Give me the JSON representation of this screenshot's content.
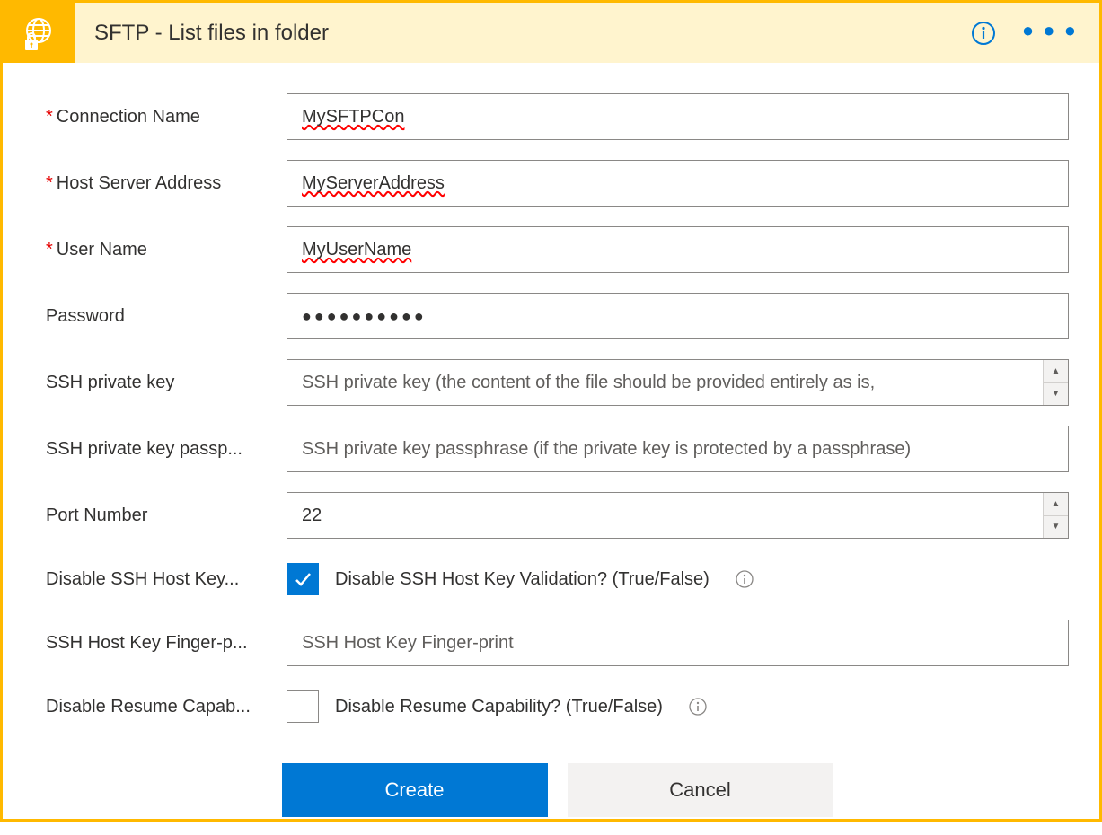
{
  "header": {
    "title": "SFTP - List files in folder"
  },
  "fields": {
    "connectionName": {
      "label": "Connection Name",
      "required": true,
      "value": "MySFTPCon"
    },
    "hostAddress": {
      "label": "Host Server Address",
      "required": true,
      "value": "MyServerAddress"
    },
    "userName": {
      "label": "User Name",
      "required": true,
      "value": "MyUserName"
    },
    "password": {
      "label": "Password",
      "required": false,
      "masked": "●●●●●●●●●●"
    },
    "sshKey": {
      "label": "SSH private key",
      "placeholder": "SSH private key (the content of the file should be provided entirely as is,"
    },
    "sshPass": {
      "label": "SSH private key passp...",
      "placeholder": "SSH private key passphrase (if the private key is protected by a passphrase)"
    },
    "port": {
      "label": "Port Number",
      "value": "22"
    },
    "disableHost": {
      "label": "Disable SSH Host Key...",
      "desc": "Disable SSH Host Key Validation? (True/False)",
      "checked": true
    },
    "fingerprint": {
      "label": "SSH Host Key Finger-p...",
      "placeholder": "SSH Host Key Finger-print"
    },
    "disableResume": {
      "label": "Disable Resume Capab...",
      "desc": "Disable Resume Capability? (True/False)",
      "checked": false
    }
  },
  "buttons": {
    "create": "Create",
    "cancel": "Cancel"
  }
}
